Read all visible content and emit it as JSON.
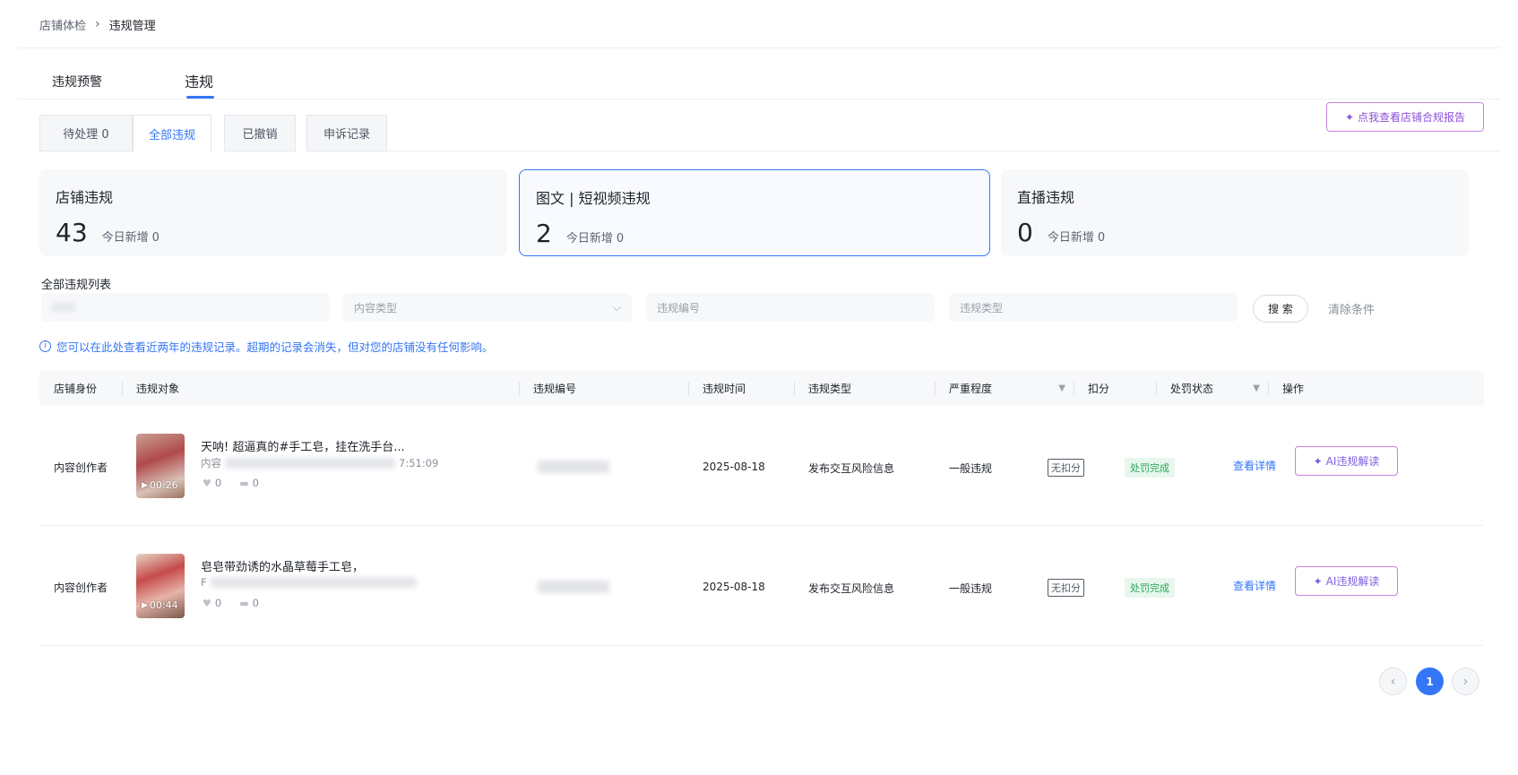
{
  "breadcrumb": {
    "parent": "店铺体检",
    "separator": "›",
    "current": "违规管理"
  },
  "main_tabs": [
    {
      "label": "违规预警"
    },
    {
      "label": "违规"
    }
  ],
  "sub_tabs": [
    {
      "label": "待处理 0"
    },
    {
      "label": "全部违规"
    },
    {
      "label": "已撤销"
    },
    {
      "label": "申诉记录"
    }
  ],
  "report_button": {
    "icon": "sparkle-icon",
    "label": "点我查看店铺合规报告"
  },
  "summary_cards": [
    {
      "title": "店铺违规",
      "count": "43",
      "today_label": "今日新增",
      "today_value": "0"
    },
    {
      "title": "图文 | 短视频违规",
      "count": "2",
      "today_label": "今日新增",
      "today_value": "0"
    },
    {
      "title": "直播违规",
      "count": "0",
      "today_label": "今日新增",
      "today_value": "0"
    }
  ],
  "list_title": "全部违规列表",
  "filters": {
    "content_type_placeholder": "内容类型",
    "violation_id_placeholder": "违规编号",
    "violation_type_placeholder": "违规类型",
    "search_label": "搜 索",
    "clear_label": "清除条件"
  },
  "notice": "您可以在此处查看近两年的违规记录。超期的记录会消失，但对您的店铺没有任何影响。",
  "table": {
    "headers": [
      "店铺身份",
      "违规对象",
      "违规编号",
      "违规时间",
      "违规类型",
      "严重程度",
      "扣分",
      "处罚状态",
      "操作"
    ],
    "rows": [
      {
        "identity": "内容创作者",
        "title": "天呐! 超逼真的#手工皂，挂在洗手台...",
        "sub_prefix": "内容",
        "sub_suffix": "7:51:09",
        "duration": "00:26",
        "likes": "0",
        "comments": "0",
        "time": "2025-08-18",
        "type": "发布交互风险信息",
        "severity": "一般违规",
        "deduction": "无扣分",
        "status": "处罚完成",
        "detail_link": "查看详情",
        "ai_label": "AI违规解读"
      },
      {
        "identity": "内容创作者",
        "title": "皂皂带劲诱的水晶草莓手工皂，",
        "sub_prefix": "F",
        "sub_suffix": "",
        "duration": "00:44",
        "likes": "0",
        "comments": "0",
        "time": "2025-08-18",
        "type": "发布交互风险信息",
        "severity": "一般违规",
        "deduction": "无扣分",
        "status": "处罚完成",
        "detail_link": "查看详情",
        "ai_label": "AI违规解读"
      }
    ]
  },
  "pagination": {
    "prev": "‹",
    "current": "1",
    "next": "›"
  },
  "colors": {
    "accent": "#3476f6",
    "ai_purple": "#8a52d8",
    "success_green": "#2ba45a"
  }
}
